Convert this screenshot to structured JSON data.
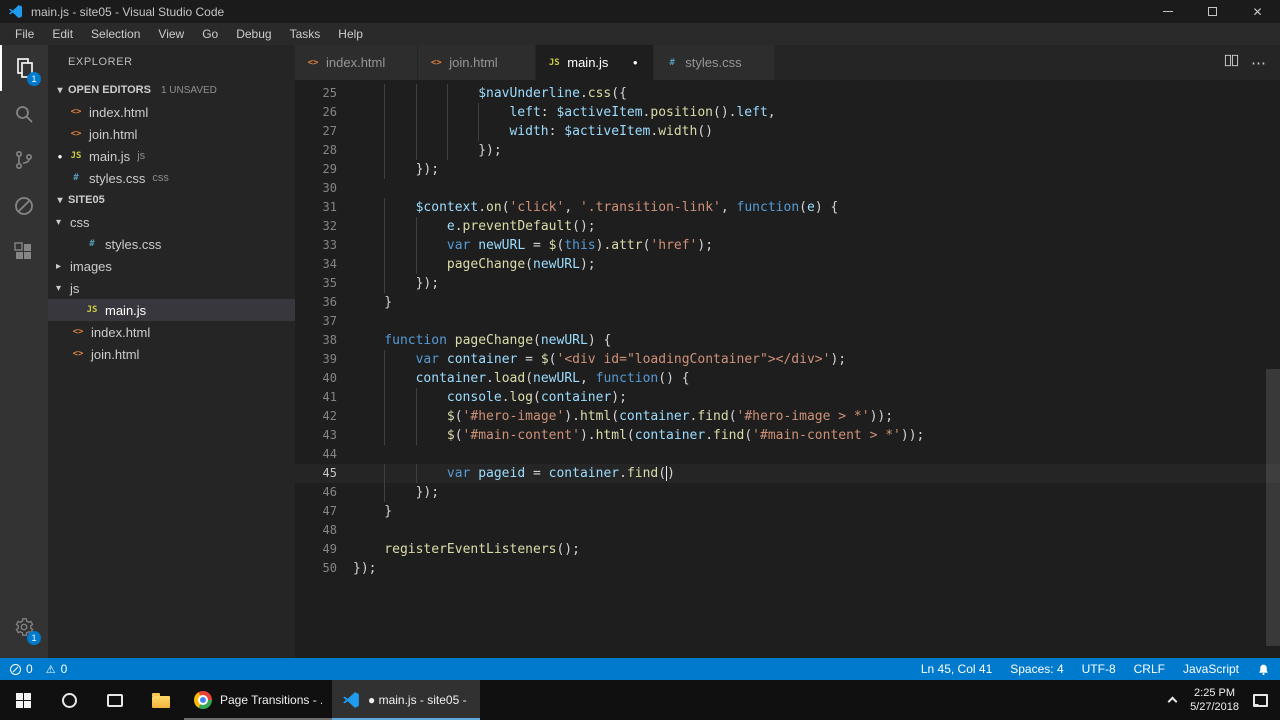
{
  "title_bar": {
    "app_title": "main.js - site05 - Visual Studio Code"
  },
  "menu_bar": {
    "items": [
      "File",
      "Edit",
      "Selection",
      "View",
      "Go",
      "Debug",
      "Tasks",
      "Help"
    ]
  },
  "activity_bar": {
    "explorer_badge": "1",
    "settings_badge": "1"
  },
  "icons": {
    "close": "✕",
    "modified_dot": "●",
    "chevron_expanded": "▾",
    "chevron_collapsed": "▸",
    "more_actions": "⋯",
    "warning": "⚠"
  },
  "file_icons": {
    "html": {
      "glyph": "<>",
      "color": "#e0823d"
    },
    "js": {
      "glyph": "JS",
      "color": "#cbcb41"
    },
    "css": {
      "glyph": "#",
      "color": "#529bba"
    }
  },
  "sidebar": {
    "title": "EXPLORER",
    "open_editors": {
      "label": "OPEN EDITORS",
      "badge": "1 UNSAVED",
      "items": [
        {
          "name": "index.html",
          "icon": "html",
          "path": "",
          "modified": false
        },
        {
          "name": "join.html",
          "icon": "html",
          "path": "",
          "modified": false
        },
        {
          "name": "main.js",
          "icon": "js",
          "path": "js",
          "modified": true
        },
        {
          "name": "styles.css",
          "icon": "css",
          "path": "css",
          "modified": false
        }
      ]
    },
    "tree": {
      "label": "SITE05",
      "items": [
        {
          "name": "css",
          "type": "folder",
          "expanded": true,
          "depth": 0
        },
        {
          "name": "styles.css",
          "type": "file",
          "icon": "css",
          "depth": 1
        },
        {
          "name": "images",
          "type": "folder",
          "expanded": false,
          "depth": 0
        },
        {
          "name": "js",
          "type": "folder",
          "expanded": true,
          "depth": 0
        },
        {
          "name": "main.js",
          "type": "file",
          "icon": "js",
          "depth": 1,
          "selected": true
        },
        {
          "name": "index.html",
          "type": "file",
          "icon": "html",
          "depth": 0
        },
        {
          "name": "join.html",
          "type": "file",
          "icon": "html",
          "depth": 0
        }
      ]
    }
  },
  "tabs": [
    {
      "name": "index.html",
      "icon": "html",
      "active": false,
      "modified": false
    },
    {
      "name": "join.html",
      "icon": "html",
      "active": false,
      "modified": false
    },
    {
      "name": "main.js",
      "icon": "js",
      "active": true,
      "modified": true
    },
    {
      "name": "styles.css",
      "icon": "css",
      "active": false,
      "modified": false
    }
  ],
  "editor": {
    "cursor_line": 45,
    "lines": [
      {
        "n": 25,
        "indent": 16,
        "tokens": [
          [
            "var",
            "$navUnderline"
          ],
          [
            "pun",
            "."
          ],
          [
            "fn",
            "css"
          ],
          [
            "pun",
            "({"
          ]
        ]
      },
      {
        "n": 26,
        "indent": 20,
        "tokens": [
          [
            "var",
            "left"
          ],
          [
            "pun",
            ": "
          ],
          [
            "var",
            "$activeItem"
          ],
          [
            "pun",
            "."
          ],
          [
            "fn",
            "position"
          ],
          [
            "pun",
            "()."
          ],
          [
            "var",
            "left"
          ],
          [
            "pun",
            ","
          ]
        ]
      },
      {
        "n": 27,
        "indent": 20,
        "tokens": [
          [
            "var",
            "width"
          ],
          [
            "pun",
            ": "
          ],
          [
            "var",
            "$activeItem"
          ],
          [
            "pun",
            "."
          ],
          [
            "fn",
            "width"
          ],
          [
            "pun",
            "()"
          ]
        ]
      },
      {
        "n": 28,
        "indent": 16,
        "tokens": [
          [
            "pun",
            "});"
          ]
        ]
      },
      {
        "n": 29,
        "indent": 8,
        "tokens": [
          [
            "pun",
            "});"
          ]
        ]
      },
      {
        "n": 30,
        "indent": 0,
        "tokens": []
      },
      {
        "n": 31,
        "indent": 8,
        "tokens": [
          [
            "var",
            "$context"
          ],
          [
            "pun",
            "."
          ],
          [
            "fn",
            "on"
          ],
          [
            "pun",
            "("
          ],
          [
            "str",
            "'click'"
          ],
          [
            "pun",
            ", "
          ],
          [
            "str",
            "'.transition-link'"
          ],
          [
            "pun",
            ", "
          ],
          [
            "kw",
            "function"
          ],
          [
            "pun",
            "("
          ],
          [
            "var",
            "e"
          ],
          [
            "pun",
            ") {"
          ]
        ]
      },
      {
        "n": 32,
        "indent": 12,
        "tokens": [
          [
            "var",
            "e"
          ],
          [
            "pun",
            "."
          ],
          [
            "fn",
            "preventDefault"
          ],
          [
            "pun",
            "();"
          ]
        ]
      },
      {
        "n": 33,
        "indent": 12,
        "tokens": [
          [
            "kw",
            "var"
          ],
          [
            "pun",
            " "
          ],
          [
            "var",
            "newURL"
          ],
          [
            "pun",
            " = "
          ],
          [
            "fn",
            "$"
          ],
          [
            "pun",
            "("
          ],
          [
            "kw",
            "this"
          ],
          [
            "pun",
            ")."
          ],
          [
            "fn",
            "attr"
          ],
          [
            "pun",
            "("
          ],
          [
            "str",
            "'href'"
          ],
          [
            "pun",
            ");"
          ]
        ]
      },
      {
        "n": 34,
        "indent": 12,
        "tokens": [
          [
            "fn",
            "pageChange"
          ],
          [
            "pun",
            "("
          ],
          [
            "var",
            "newURL"
          ],
          [
            "pun",
            ");"
          ]
        ]
      },
      {
        "n": 35,
        "indent": 8,
        "tokens": [
          [
            "pun",
            "});"
          ]
        ]
      },
      {
        "n": 36,
        "indent": 4,
        "tokens": [
          [
            "pun",
            "}"
          ]
        ]
      },
      {
        "n": 37,
        "indent": 0,
        "tokens": []
      },
      {
        "n": 38,
        "indent": 4,
        "tokens": [
          [
            "kw",
            "function"
          ],
          [
            "pun",
            " "
          ],
          [
            "fn",
            "pageChange"
          ],
          [
            "pun",
            "("
          ],
          [
            "var",
            "newURL"
          ],
          [
            "pun",
            ") {"
          ]
        ]
      },
      {
        "n": 39,
        "indent": 8,
        "tokens": [
          [
            "kw",
            "var"
          ],
          [
            "pun",
            " "
          ],
          [
            "var",
            "container"
          ],
          [
            "pun",
            " = "
          ],
          [
            "fn",
            "$"
          ],
          [
            "pun",
            "("
          ],
          [
            "str",
            "'<div id=\"loadingContainer\"></div>'"
          ],
          [
            "pun",
            ");"
          ]
        ]
      },
      {
        "n": 40,
        "indent": 8,
        "tokens": [
          [
            "var",
            "container"
          ],
          [
            "pun",
            "."
          ],
          [
            "fn",
            "load"
          ],
          [
            "pun",
            "("
          ],
          [
            "var",
            "newURL"
          ],
          [
            "pun",
            ", "
          ],
          [
            "kw",
            "function"
          ],
          [
            "pun",
            "() {"
          ]
        ]
      },
      {
        "n": 41,
        "indent": 12,
        "tokens": [
          [
            "var",
            "console"
          ],
          [
            "pun",
            "."
          ],
          [
            "fn",
            "log"
          ],
          [
            "pun",
            "("
          ],
          [
            "var",
            "container"
          ],
          [
            "pun",
            ");"
          ]
        ]
      },
      {
        "n": 42,
        "indent": 12,
        "tokens": [
          [
            "fn",
            "$"
          ],
          [
            "pun",
            "("
          ],
          [
            "str",
            "'#hero-image'"
          ],
          [
            "pun",
            ")."
          ],
          [
            "fn",
            "html"
          ],
          [
            "pun",
            "("
          ],
          [
            "var",
            "container"
          ],
          [
            "pun",
            "."
          ],
          [
            "fn",
            "find"
          ],
          [
            "pun",
            "("
          ],
          [
            "str",
            "'#hero-image > *'"
          ],
          [
            "pun",
            "));"
          ]
        ]
      },
      {
        "n": 43,
        "indent": 12,
        "tokens": [
          [
            "fn",
            "$"
          ],
          [
            "pun",
            "("
          ],
          [
            "str",
            "'#main-content'"
          ],
          [
            "pun",
            ")."
          ],
          [
            "fn",
            "html"
          ],
          [
            "pun",
            "("
          ],
          [
            "var",
            "container"
          ],
          [
            "pun",
            "."
          ],
          [
            "fn",
            "find"
          ],
          [
            "pun",
            "("
          ],
          [
            "str",
            "'#main-content > *'"
          ],
          [
            "pun",
            "));"
          ]
        ]
      },
      {
        "n": 44,
        "indent": 0,
        "tokens": []
      },
      {
        "n": 45,
        "indent": 12,
        "tokens": [
          [
            "kw",
            "var"
          ],
          [
            "pun",
            " "
          ],
          [
            "var",
            "pageid"
          ],
          [
            "pun",
            " = "
          ],
          [
            "var",
            "container"
          ],
          [
            "pun",
            "."
          ],
          [
            "fn",
            "find"
          ],
          [
            "pun",
            "("
          ],
          [
            "cursor",
            ""
          ],
          [
            "pun",
            ")"
          ]
        ]
      },
      {
        "n": 46,
        "indent": 8,
        "tokens": [
          [
            "pun",
            "});"
          ]
        ]
      },
      {
        "n": 47,
        "indent": 4,
        "tokens": [
          [
            "pun",
            "}"
          ]
        ]
      },
      {
        "n": 48,
        "indent": 0,
        "tokens": []
      },
      {
        "n": 49,
        "indent": 4,
        "tokens": [
          [
            "fn",
            "registerEventListeners"
          ],
          [
            "pun",
            "();"
          ]
        ]
      },
      {
        "n": 50,
        "indent": 0,
        "tokens": [
          [
            "pun",
            "});"
          ]
        ]
      }
    ]
  },
  "status_bar": {
    "errors": "0",
    "warnings": "0",
    "line_col": "Ln 45, Col 41",
    "indentation": "Spaces: 4",
    "encoding": "UTF-8",
    "eol": "CRLF",
    "language": "JavaScript"
  },
  "taskbar": {
    "apps": [
      {
        "label": "Page Transitions - ...",
        "icon": "chrome-icon",
        "active": false
      },
      {
        "label": "● main.js - site05 - ...",
        "icon": "vscode-icon",
        "active": true
      }
    ],
    "clock": {
      "time": "2:25 PM",
      "date": "5/27/2018"
    }
  },
  "colors": {
    "accent": "#007acc"
  }
}
